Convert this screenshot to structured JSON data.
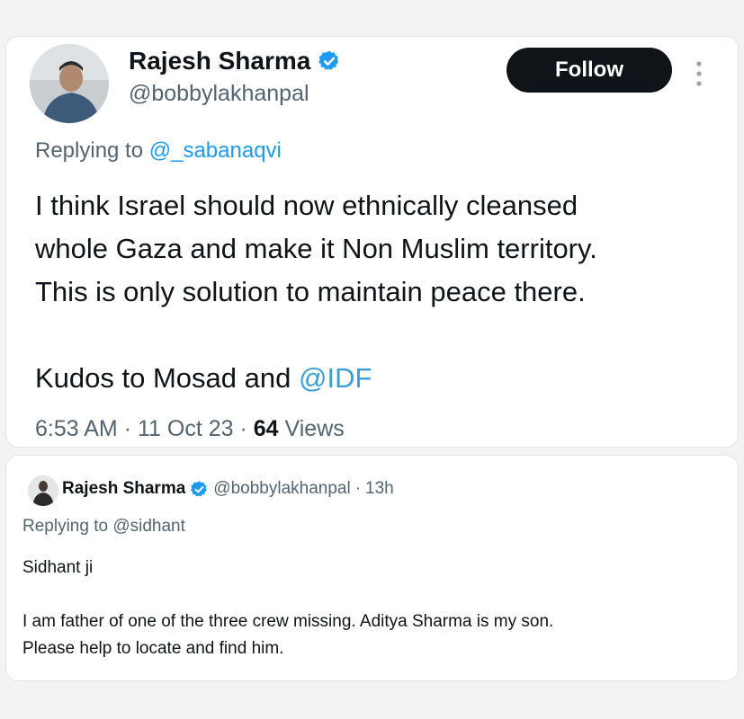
{
  "main_tweet": {
    "author_name": "Rajesh Sharma",
    "author_handle": "@bobbylakhanpal",
    "follow_label": "Follow",
    "replying_prefix": "Replying to",
    "replying_to": "@_sabanaqvi",
    "text_lines": [
      "I think Israel should now ethnically cleansed",
      "whole Gaza and make it Non Muslim territory.",
      "This is only solution to maintain peace there."
    ],
    "kudos_prefix": "Kudos to Mosad and",
    "kudos_mention": "@IDF",
    "time": "6:53 AM",
    "separator": "·",
    "date": "11 Oct 23",
    "views_count": "64",
    "views_label": "Views",
    "icons": {
      "verified": "verified-badge-icon",
      "more": "more-vertical-icon"
    }
  },
  "reply_tweet": {
    "author_name": "Rajesh Sharma",
    "author_handle": "@bobbylakhanpal",
    "separator": "·",
    "age": "13h",
    "replying_prefix": "Replying to",
    "replying_to": "@sidhant",
    "greeting": "Sidhant ji",
    "body_lines": [
      "I am father of one of the three crew missing. Aditya Sharma is my son.",
      "Please help to locate and find him."
    ]
  },
  "colors": {
    "background": "#f3f3f3",
    "card": "#ffffff",
    "text_primary": "#0f1419",
    "text_secondary": "#536471",
    "link": "#1d9bf0",
    "verified": "#1d9bf0",
    "follow_button": "#0f1419"
  }
}
